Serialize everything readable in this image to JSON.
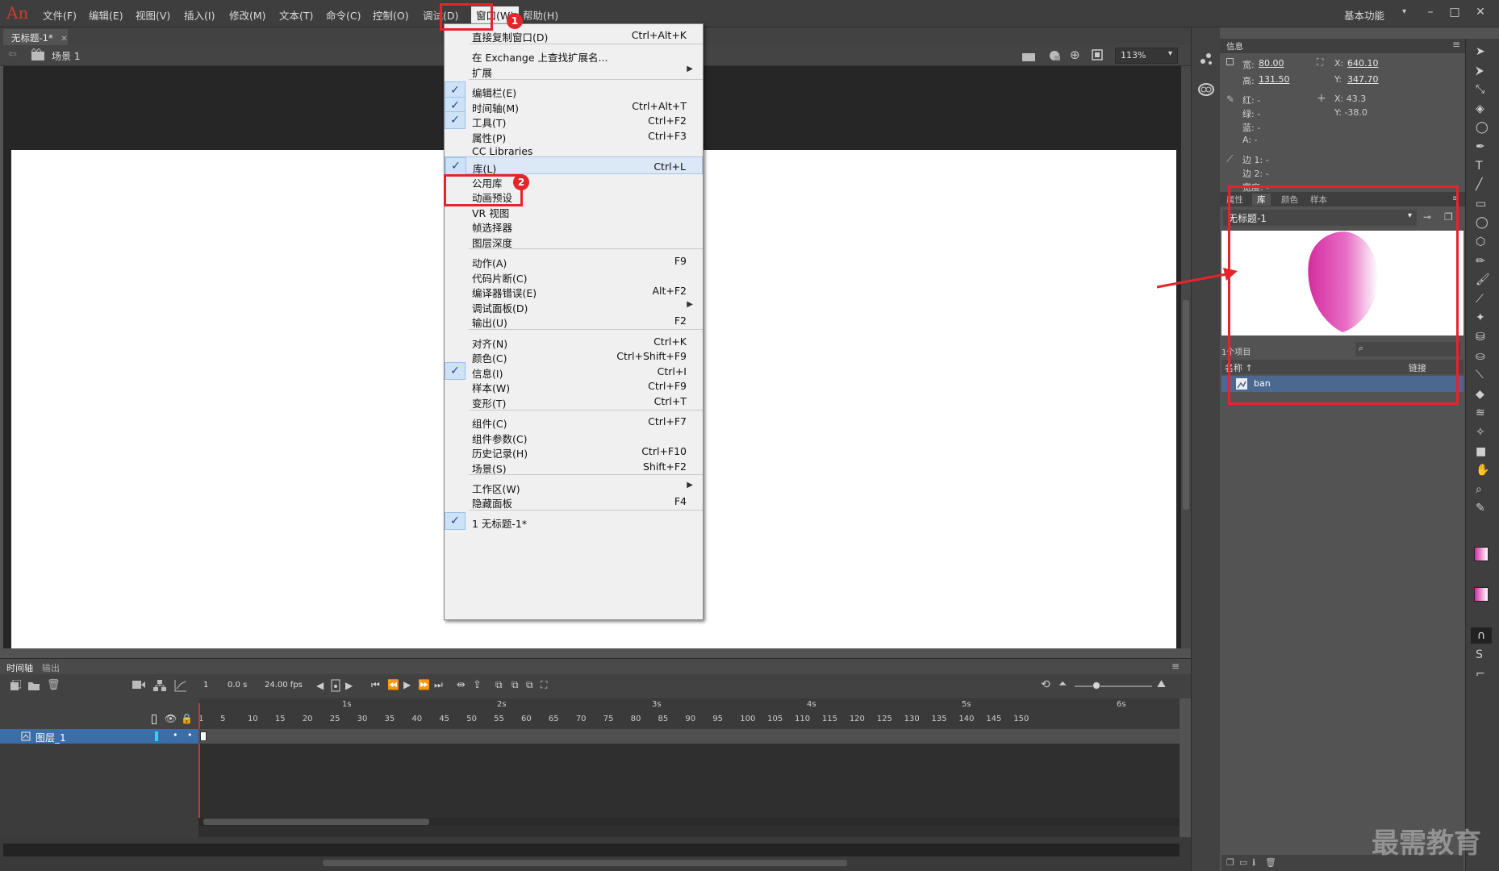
{
  "app": {
    "logo": "An"
  },
  "menubar": {
    "items": [
      "文件(F)",
      "编辑(E)",
      "视图(V)",
      "插入(I)",
      "修改(M)",
      "文本(T)",
      "命令(C)",
      "控制(O)",
      "调试(D)",
      "窗口(W)",
      "帮助(H)"
    ],
    "workspace": "基本功能"
  },
  "document": {
    "tab_title": "无标题-1*",
    "scene": "场景 1",
    "zoom": "113%"
  },
  "window_menu": {
    "items": [
      {
        "label": "直接复制窗口(D)",
        "shortcut": "Ctrl+Alt+K",
        "checked": false
      },
      {
        "label": "在 Exchange 上查找扩展名...",
        "shortcut": "",
        "checked": false
      },
      {
        "label": "扩展",
        "shortcut": "",
        "checked": false,
        "submenu": true
      },
      {
        "label": "编辑栏(E)",
        "shortcut": "",
        "checked": true
      },
      {
        "label": "时间轴(M)",
        "shortcut": "Ctrl+Alt+T",
        "checked": true
      },
      {
        "label": "工具(T)",
        "shortcut": "Ctrl+F2",
        "checked": true
      },
      {
        "label": "属性(P)",
        "shortcut": "Ctrl+F3",
        "checked": false
      },
      {
        "label": "CC Libraries",
        "shortcut": "",
        "checked": false
      },
      {
        "label": "库(L)",
        "shortcut": "Ctrl+L",
        "checked": true,
        "highlighted": true
      },
      {
        "label": "公用库",
        "shortcut": "",
        "checked": false
      },
      {
        "label": "动画预设",
        "shortcut": "",
        "checked": false
      },
      {
        "label": "VR 视图",
        "shortcut": "",
        "checked": false
      },
      {
        "label": "帧选择器",
        "shortcut": "",
        "checked": false
      },
      {
        "label": "图层深度",
        "shortcut": "",
        "checked": false
      },
      {
        "label": "动作(A)",
        "shortcut": "F9",
        "checked": false
      },
      {
        "label": "代码片断(C)",
        "shortcut": "",
        "checked": false
      },
      {
        "label": "编译器错误(E)",
        "shortcut": "Alt+F2",
        "checked": false
      },
      {
        "label": "调试面板(D)",
        "shortcut": "",
        "checked": false,
        "submenu": true
      },
      {
        "label": "输出(U)",
        "shortcut": "F2",
        "checked": false
      },
      {
        "label": "对齐(N)",
        "shortcut": "Ctrl+K",
        "checked": false
      },
      {
        "label": "颜色(C)",
        "shortcut": "Ctrl+Shift+F9",
        "checked": false
      },
      {
        "label": "信息(I)",
        "shortcut": "Ctrl+I",
        "checked": true
      },
      {
        "label": "样本(W)",
        "shortcut": "Ctrl+F9",
        "checked": false
      },
      {
        "label": "变形(T)",
        "shortcut": "Ctrl+T",
        "checked": false
      },
      {
        "label": "组件(C)",
        "shortcut": "Ctrl+F7",
        "checked": false
      },
      {
        "label": "组件参数(C)",
        "shortcut": "",
        "checked": false
      },
      {
        "label": "历史记录(H)",
        "shortcut": "Ctrl+F10",
        "checked": false
      },
      {
        "label": "场景(S)",
        "shortcut": "Shift+F2",
        "checked": false
      },
      {
        "label": "工作区(W)",
        "shortcut": "",
        "checked": false,
        "submenu": true
      },
      {
        "label": "隐藏面板",
        "shortcut": "F4",
        "checked": false
      },
      {
        "label": "1 无标题-1*",
        "shortcut": "",
        "checked": true
      }
    ]
  },
  "info_panel": {
    "title": "信息",
    "width_label": "宽:",
    "width": "80.00",
    "height_label": "高:",
    "height": "131.50",
    "x_label": "X:",
    "x": "640.10",
    "y_label": "Y:",
    "y": "347.70",
    "red_label": "红: -",
    "green_label": "绿: -",
    "blue_label": "蓝: -",
    "alpha_label": "A: -",
    "cursor_x": "X: 43.3",
    "cursor_y": "Y: -38.0",
    "edge1": "边 1: -",
    "edge2": "边 2: -",
    "stroke_width": "宽度: -"
  },
  "library_panel": {
    "tabs": [
      "属性",
      "库",
      "颜色",
      "样本"
    ],
    "document": "无标题-1",
    "item_count": "1个项目",
    "col_name": "名称 ↑",
    "col_link": "链接",
    "items": [
      "ban"
    ]
  },
  "timeline": {
    "tabs": [
      "时间轴",
      "输出"
    ],
    "frame": "1",
    "time": "0.0 s",
    "fps": "24.00 fps",
    "layer_name": "图层_1",
    "seconds": [
      "1s",
      "2s",
      "3s",
      "4s",
      "5s",
      "6s"
    ],
    "frame_numbers": [
      "1",
      "5",
      "10",
      "15",
      "20",
      "25",
      "30",
      "35",
      "40",
      "45",
      "50",
      "55",
      "60",
      "65",
      "70",
      "75",
      "80",
      "85",
      "90",
      "95",
      "100",
      "105",
      "110",
      "115",
      "120",
      "125",
      "130",
      "135",
      "140",
      "145",
      "150"
    ]
  },
  "annotations": {
    "badge1": "1",
    "badge2": "2"
  },
  "watermark": "最需教育",
  "colors": {
    "accent_red": "#e5252b",
    "gradient_start": "#d42ca0",
    "gradient_end": "#ffffff",
    "selected_layer": "#3b6ea9"
  }
}
